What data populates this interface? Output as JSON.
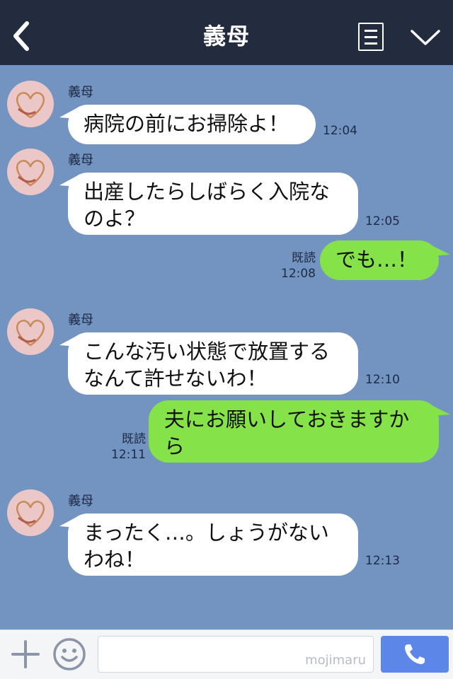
{
  "header": {
    "title": "義母"
  },
  "messages": [
    {
      "sender": "義母",
      "side": "in",
      "lines": [
        "病院の前にお掃除よ！"
      ],
      "time": "12:04"
    },
    {
      "sender": "義母",
      "side": "in",
      "lines": [
        "出産したらしばらく入院な",
        "のよ？"
      ],
      "time": "12:05"
    },
    {
      "side": "out",
      "lines": [
        "でも…！"
      ],
      "read": "既読",
      "time": "12:08"
    },
    {
      "sender": "義母",
      "side": "in",
      "lines": [
        "こんな汚い状態で放置する",
        "なんて許せないわ！"
      ],
      "time": "12:10"
    },
    {
      "side": "out",
      "lines": [
        "夫にお願いしておきますか",
        "ら"
      ],
      "read": "既読",
      "time": "12:11"
    },
    {
      "sender": "義母",
      "side": "in",
      "lines": [
        "まったく…。しょうがない",
        "わね！"
      ],
      "time": "12:13"
    }
  ],
  "footer": {
    "input_value": "",
    "watermark": "mojimaru",
    "icons": [
      "plus-icon",
      "emoji-icon",
      "phone-icon"
    ],
    "call_color": "#5c87e8"
  },
  "colors": {
    "header_bg": "#232c3e",
    "chat_bg": "#7394c0",
    "incoming_bubble": "#ffffff",
    "outgoing_bubble": "#85e249"
  }
}
